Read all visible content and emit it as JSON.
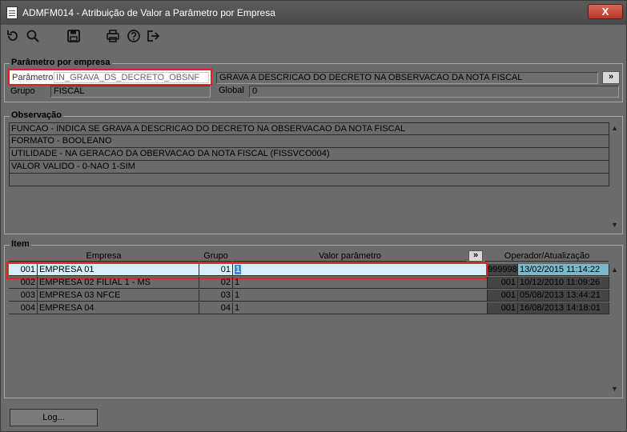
{
  "window": {
    "title": "ADMFM014 - Atribuição de Valor a Parâmetro por Empresa",
    "close_label": "X"
  },
  "toolbar": {
    "icons": [
      "refresh-icon",
      "search-icon",
      "save-icon",
      "print-icon",
      "help-icon",
      "exit-icon"
    ]
  },
  "parametro_section": {
    "legend": "Parâmetro por empresa",
    "parametro_label": "Parâmetro",
    "parametro_value": "IN_GRAVA_DS_DECRETO_OBSNF",
    "descricao_value": "GRAVA A DESCRICAO DO DECRETO NA OBSERVACAO DA NOTA FISCAL",
    "more_button": "»",
    "grupo_label": "Grupo",
    "grupo_value": "FISCAL",
    "global_label": "Global",
    "global_value": "0"
  },
  "observacao_section": {
    "legend": "Observação",
    "lines": [
      "FUNCAO - INDICA SE GRAVA A DESCRICAO DO DECRETO NA OBSERVACAO DA NOTA FISCAL",
      "FORMATO - BOOLEANO",
      "UTILIDADE - NA GERACAO DA OBERVACAO DA NOTA FISCAL (FISSVCO004)",
      "VALOR VALIDO - 0-NAO  1-SIM",
      ""
    ]
  },
  "item_section": {
    "legend": "Item",
    "columns": {
      "empresa": "Empresa",
      "grupo": "Grupo",
      "valor": "Valor parâmetro",
      "more": "»",
      "operador": "Operador/Atualização"
    },
    "rows": [
      {
        "cod": "001",
        "empresa": "EMPRESA 01",
        "grupo": "01",
        "valor": "1",
        "operador": "999998",
        "atualizacao": "13/02/2015 11:14:22"
      },
      {
        "cod": "002",
        "empresa": "EMPRESA 02 FILIAL 1 - MS",
        "grupo": "02",
        "valor": "1",
        "operador": "001",
        "atualizacao": "10/12/2010 11:09:26"
      },
      {
        "cod": "003",
        "empresa": "EMPRESA 03 NFCE",
        "grupo": "03",
        "valor": "1",
        "operador": "001",
        "atualizacao": "05/08/2013 13:44:21"
      },
      {
        "cod": "004",
        "empresa": "EMPRESA 04",
        "grupo": "04",
        "valor": "1",
        "operador": "001",
        "atualizacao": "16/08/2013 14:18:01"
      }
    ]
  },
  "footer": {
    "log_button": "Log..."
  },
  "colors": {
    "highlight": "#e0221b",
    "window_bg": "#6b6b6b",
    "selected_row": "#d6eef8",
    "selected_date": "#7ab8cc"
  }
}
